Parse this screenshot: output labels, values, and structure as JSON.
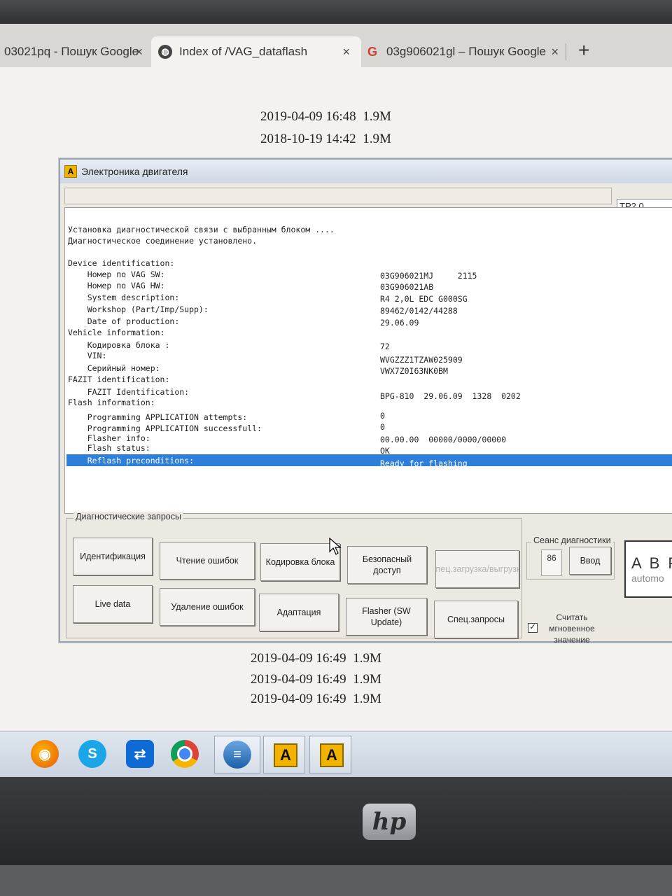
{
  "browser": {
    "tabs": [
      {
        "title": "03021pq - Пошук Google",
        "icon": "google-icon",
        "active": false
      },
      {
        "title": "Index of /VAG_dataflash",
        "icon": "globe-icon",
        "active": true
      },
      {
        "title": "03g906021gl – Пошук Google",
        "icon": "google-icon",
        "active": false
      }
    ],
    "close_glyph": "×",
    "new_tab_glyph": "+"
  },
  "listing_top": [
    {
      "date": "2019-04-09 16:48",
      "size": "1.9M"
    },
    {
      "date": "2018-10-19 14:42",
      "size": "1.9M"
    }
  ],
  "listing_bottom": [
    {
      "date": "2019-04-09 16:49",
      "size": "1.9M"
    },
    {
      "date": "2019-04-09 16:49",
      "size": "1.9M"
    },
    {
      "date": "2019-04-09 16:49",
      "size": "1.9M"
    }
  ],
  "app": {
    "title": "Электроника двигателя",
    "icon_letter": "A",
    "protocol": "TP2.0",
    "log": [
      {
        "label": "Установка диагностической связи с выбранным блоком ....",
        "value": ""
      },
      {
        "label": "Диагностическое соединение установлено.",
        "value": ""
      },
      {
        "label": "Device identification:",
        "value": ""
      },
      {
        "label": "    Номер по VAG SW:",
        "value": "03G906021MJ     2115"
      },
      {
        "label": "    Номер по VAG HW:",
        "value": "03G906021AB"
      },
      {
        "label": "    System description:",
        "value": "R4 2,0L EDC G000SG"
      },
      {
        "label": "    Workshop (Part/Imp/Supp):",
        "value": "89462/0142/44288"
      },
      {
        "label": "    Date of production:",
        "value": "29.06.09"
      },
      {
        "label": "Vehicle information:",
        "value": ""
      },
      {
        "label": "    Кодировка блока :",
        "value": "72"
      },
      {
        "label": "    VIN:",
        "value": ""
      },
      {
        "label": "    Серийный номер:",
        "value": "WVGZZZ1TZAW025909"
      },
      {
        "label": "FAZIT identification:",
        "value": "VWX7Z0I63NK0BM"
      },
      {
        "label": "    FAZIT Identification:",
        "value": ""
      },
      {
        "label": "Flash information:",
        "value": "BPG-810  29.06.09  1328  0202"
      },
      {
        "label": "    Programming APPLICATION attempts:",
        "value": "0"
      },
      {
        "label": "    Programming APPLICATION successfull:",
        "value": "0"
      },
      {
        "label": "    Flasher info:",
        "value": "00.00.00  00000/0000/00000"
      },
      {
        "label": "    Flash status:",
        "value": "OK"
      },
      {
        "label": "    Reflash preconditions:",
        "value": "Ready for flashing"
      }
    ],
    "group_label": "Диагностические запросы",
    "buttons": [
      "Идентификация",
      "Чтение ошибок",
      "Кодировка блока",
      "Безопасный доступ",
      "Спец.загрузка/выгрузка",
      "Live data",
      "Удаление ошибок",
      "Адаптация",
      "Flasher (SW Update)",
      "Спец.запросы"
    ],
    "session": {
      "label": "Сеанс диагностики",
      "value": "86",
      "enter": "Ввод"
    },
    "checkbox": {
      "checked": true,
      "label": "Считать мгновенное значение",
      "mark": "✓"
    },
    "logo": {
      "text": "A B R",
      "sub": "automo"
    }
  },
  "taskbar": {
    "icons": [
      "firefox-icon",
      "skype-icon",
      "teamviewer-icon",
      "chrome-icon",
      "ie-icon"
    ],
    "apps": [
      "A",
      "A"
    ]
  },
  "monitor": {
    "brand": "hp"
  }
}
